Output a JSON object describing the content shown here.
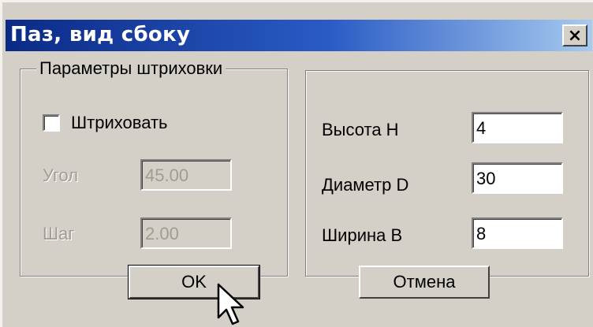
{
  "window": {
    "title": "Паз, вид сбоку",
    "close_glyph": "×"
  },
  "hatch_group": {
    "legend": "Параметры штриховки",
    "checkbox_label": "Штриховать",
    "checked": false,
    "angle_label": "Угол",
    "angle_value": "45.00",
    "step_label": "Шаг",
    "step_value": "2.00"
  },
  "dimensions": {
    "height_label": "Высота Н",
    "height_value": "4",
    "diameter_label": "Диаметр D",
    "diameter_value": "30",
    "width_label": "Ширина В",
    "width_value": "8"
  },
  "buttons": {
    "ok": "OK",
    "cancel": "Отмена"
  },
  "cursor": {
    "icon": "arrow-pointer-icon"
  }
}
